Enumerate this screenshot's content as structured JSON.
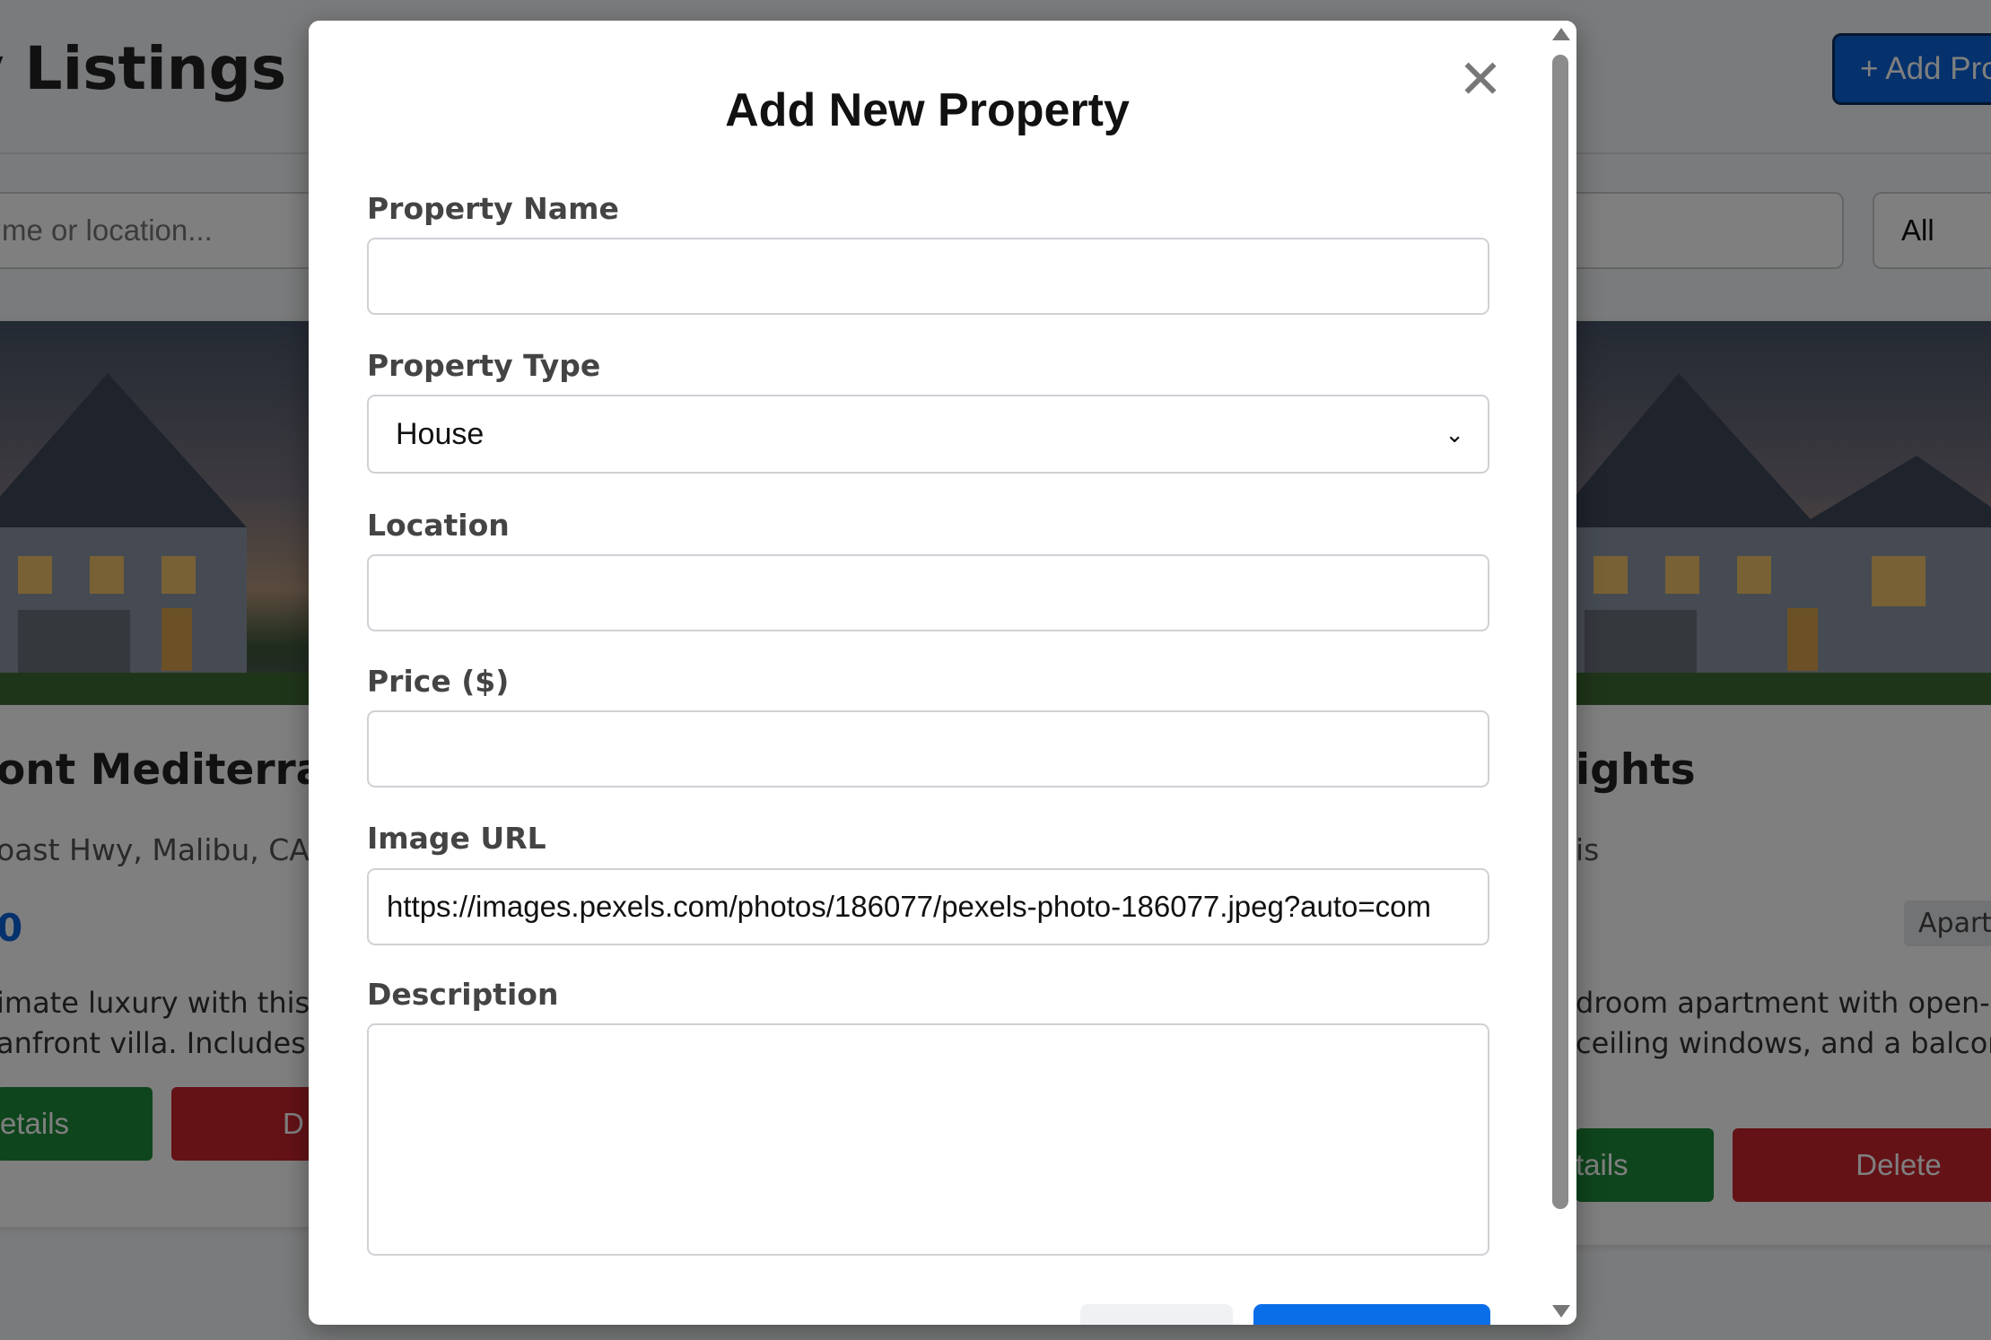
{
  "page": {
    "title": "ty Listings",
    "add_button_label": "+ Add Pro",
    "search_placeholder": "me or location...",
    "filter_value": "All"
  },
  "cards": [
    {
      "name": "ont Mediterrane",
      "location": "oast Hwy, Malibu, CA",
      "price": "0",
      "description_lines": [
        "imate luxury with this br",
        "anfront villa. Includes a p"
      ],
      "details_label": "etails",
      "delete_label": "D"
    },
    {
      "name": "ights",
      "location": "is",
      "type_badge": "Apartr",
      "description_lines": [
        "droom apartment with open-pla",
        "ceiling windows, and a balcony v"
      ],
      "details_label": "tails",
      "delete_label": "Delete"
    }
  ],
  "modal": {
    "title": "Add New Property",
    "close_symbol": "✕",
    "fields": {
      "name_label": "Property Name",
      "name_value": "",
      "type_label": "Property Type",
      "type_value": "House",
      "location_label": "Location",
      "location_value": "",
      "price_label": "Price ($)",
      "price_value": "",
      "image_label": "Image URL",
      "image_value": "https://images.pexels.com/photos/186077/pexels-photo-186077.jpeg?auto=com",
      "description_label": "Description",
      "description_value": ""
    }
  },
  "colors": {
    "primary": "#0a63d8",
    "success": "#1e8a3a",
    "danger": "#c8242d",
    "overlay": "rgba(0,0,0,0.5)"
  }
}
